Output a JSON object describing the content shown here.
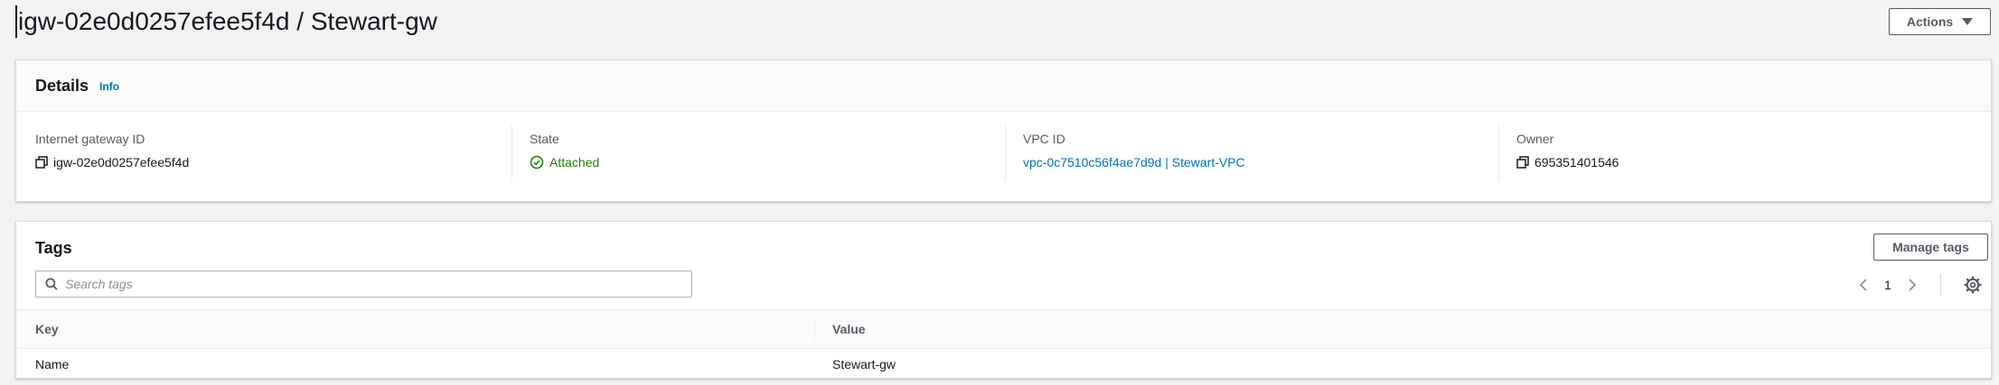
{
  "header": {
    "title": "igw-02e0d0257efee5f4d / Stewart-gw",
    "actions_label": "Actions"
  },
  "details": {
    "title": "Details",
    "info_label": "Info",
    "columns": [
      {
        "label": "Internet gateway ID",
        "value": "igw-02e0d0257efee5f4d",
        "icon": "copy-icon"
      },
      {
        "label": "State",
        "value": "Attached",
        "icon": "check-circle-icon"
      },
      {
        "label": "VPC ID",
        "value": "vpc-0c7510c56f4ae7d9d | Stewart-VPC"
      },
      {
        "label": "Owner",
        "value": "695351401546",
        "icon": "copy-icon"
      }
    ]
  },
  "tags": {
    "title": "Tags",
    "manage_label": "Manage tags",
    "search_placeholder": "Search tags",
    "page": "1",
    "columns": [
      "Key",
      "Value"
    ],
    "rows": [
      {
        "key": "Name",
        "value": "Stewart-gw"
      }
    ]
  },
  "colors": {
    "background": "#f2f3f3",
    "link": "#0073bb",
    "success": "#1d8102",
    "text": "#16191f",
    "muted": "#545b64"
  }
}
